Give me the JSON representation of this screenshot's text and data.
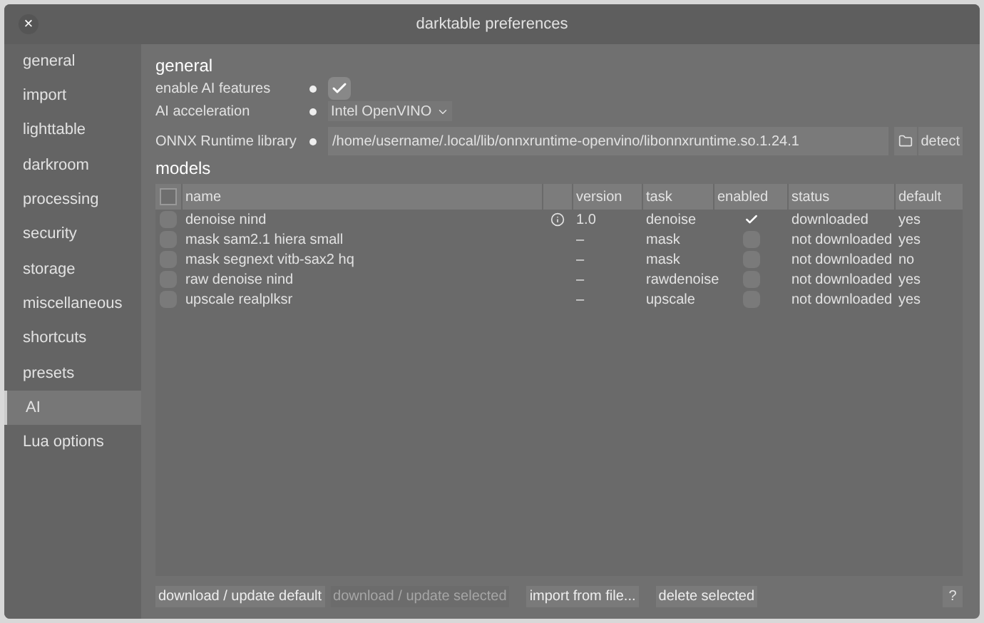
{
  "window": {
    "title": "darktable preferences",
    "close": "×"
  },
  "sidebar": {
    "items": [
      {
        "label": "general",
        "selected": false
      },
      {
        "label": "import",
        "selected": false
      },
      {
        "label": "lighttable",
        "selected": false
      },
      {
        "label": "darkroom",
        "selected": false
      },
      {
        "label": "processing",
        "selected": false
      },
      {
        "label": "security",
        "selected": false
      },
      {
        "label": "storage",
        "selected": false
      },
      {
        "label": "miscellaneous",
        "selected": false
      },
      {
        "label": "shortcuts",
        "selected": false
      },
      {
        "label": "presets",
        "selected": false
      },
      {
        "label": "AI",
        "selected": true
      },
      {
        "label": "Lua options",
        "selected": false
      }
    ]
  },
  "general": {
    "heading": "general",
    "enable_ai": {
      "label": "enable AI features",
      "checked": true
    },
    "acceleration": {
      "label": "AI acceleration",
      "value": "Intel OpenVINO"
    },
    "onnx": {
      "label": "ONNX Runtime library",
      "value": "/home/username/.local/lib/onnxruntime-openvino/libonnxruntime.so.1.24.1",
      "detect": "detect"
    }
  },
  "models": {
    "heading": "models",
    "select_all": false,
    "columns": [
      "name",
      "version",
      "task",
      "enabled",
      "status",
      "default"
    ],
    "rows": [
      {
        "selected": false,
        "name": "denoise nind",
        "info": true,
        "version": "1.0",
        "task": "denoise",
        "enabled": true,
        "status": "downloaded",
        "default": "yes"
      },
      {
        "selected": false,
        "name": "mask sam2.1 hiera small",
        "info": false,
        "version": "–",
        "task": "mask",
        "enabled": false,
        "status": "not downloaded",
        "default": "yes"
      },
      {
        "selected": false,
        "name": "mask segnext vitb-sax2 hq",
        "info": false,
        "version": "–",
        "task": "mask",
        "enabled": false,
        "status": "not downloaded",
        "default": "no"
      },
      {
        "selected": false,
        "name": "raw denoise nind",
        "info": false,
        "version": "–",
        "task": "rawdenoise",
        "enabled": false,
        "status": "not downloaded",
        "default": "yes"
      },
      {
        "selected": false,
        "name": "upscale realplksr",
        "info": false,
        "version": "–",
        "task": "upscale",
        "enabled": false,
        "status": "not downloaded",
        "default": "yes"
      }
    ]
  },
  "buttons": [
    {
      "label": "download / update default",
      "disabled": false
    },
    {
      "label": "download / update selected",
      "disabled": true
    },
    {
      "label": "import from file...",
      "disabled": false
    },
    {
      "label": "delete selected",
      "disabled": false
    }
  ],
  "help": "?"
}
